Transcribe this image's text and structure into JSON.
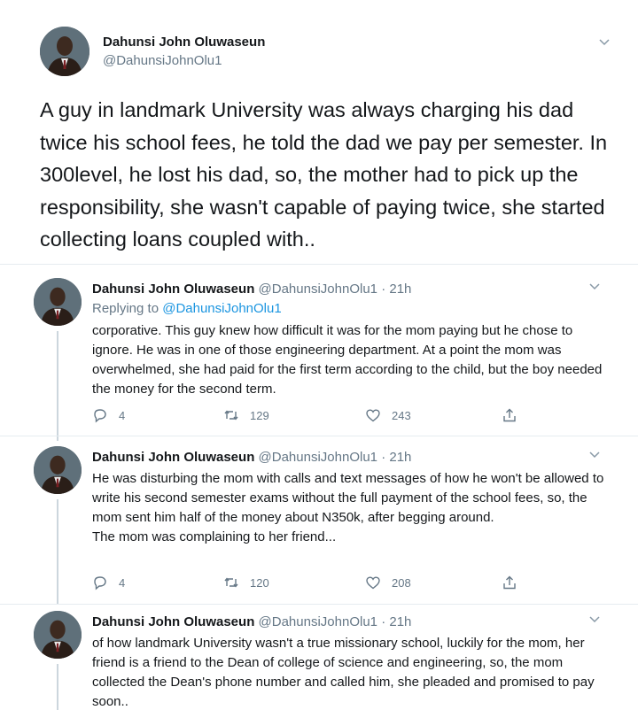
{
  "main_tweet": {
    "author_name": "Dahunsi John Oluwaseun",
    "handle": "@DahunsiJohnOlu1",
    "text": "A guy in landmark University was always charging his dad twice his school fees, he told the dad we pay per semester. In 300level, he lost his dad, so, the mother had to pick up the responsibility, she wasn't capable of paying twice, she started collecting loans coupled with.."
  },
  "replies": [
    {
      "author_name": "Dahunsi John Oluwaseun",
      "handle": "@DahunsiJohnOlu1",
      "time": "· 21h",
      "replying_prefix": "Replying to",
      "replying_to": "@DahunsiJohnOlu1",
      "text": "corporative. This guy knew how difficult it was for the mom paying but he chose to ignore. He was in one of those engineering department. At a point the mom was overwhelmed, she had paid for the first term according to the child, but the boy needed the money for the second term.",
      "replies_count": "4",
      "retweets_count": "129",
      "likes_count": "243"
    },
    {
      "author_name": "Dahunsi John Oluwaseun",
      "handle": "@DahunsiJohnOlu1",
      "time": "· 21h",
      "text": "He was disturbing the mom with calls and text messages of how he won't be allowed to write his second semester exams without the full payment of the school fees, so, the mom sent him half of the money about N350k, after begging around.\nThe mom was complaining to her friend...",
      "replies_count": "4",
      "retweets_count": "120",
      "likes_count": "208"
    },
    {
      "author_name": "Dahunsi John Oluwaseun",
      "handle": "@DahunsiJohnOlu1",
      "time": "· 21h",
      "text": "of how landmark University wasn't a true missionary school, luckily for the mom, her friend is a friend to the Dean of college of science and engineering, so, the mom collected the Dean's phone number and called him, she pleaded and promised to pay soon.."
    }
  ],
  "colors": {
    "text": "#14171a",
    "secondary": "#657786",
    "link": "#1b95e0",
    "divider": "#e6ecf0",
    "thread_line": "#ccd6dd"
  },
  "icons": [
    "chevron-down-icon",
    "reply-icon",
    "retweet-icon",
    "like-icon",
    "share-icon"
  ]
}
